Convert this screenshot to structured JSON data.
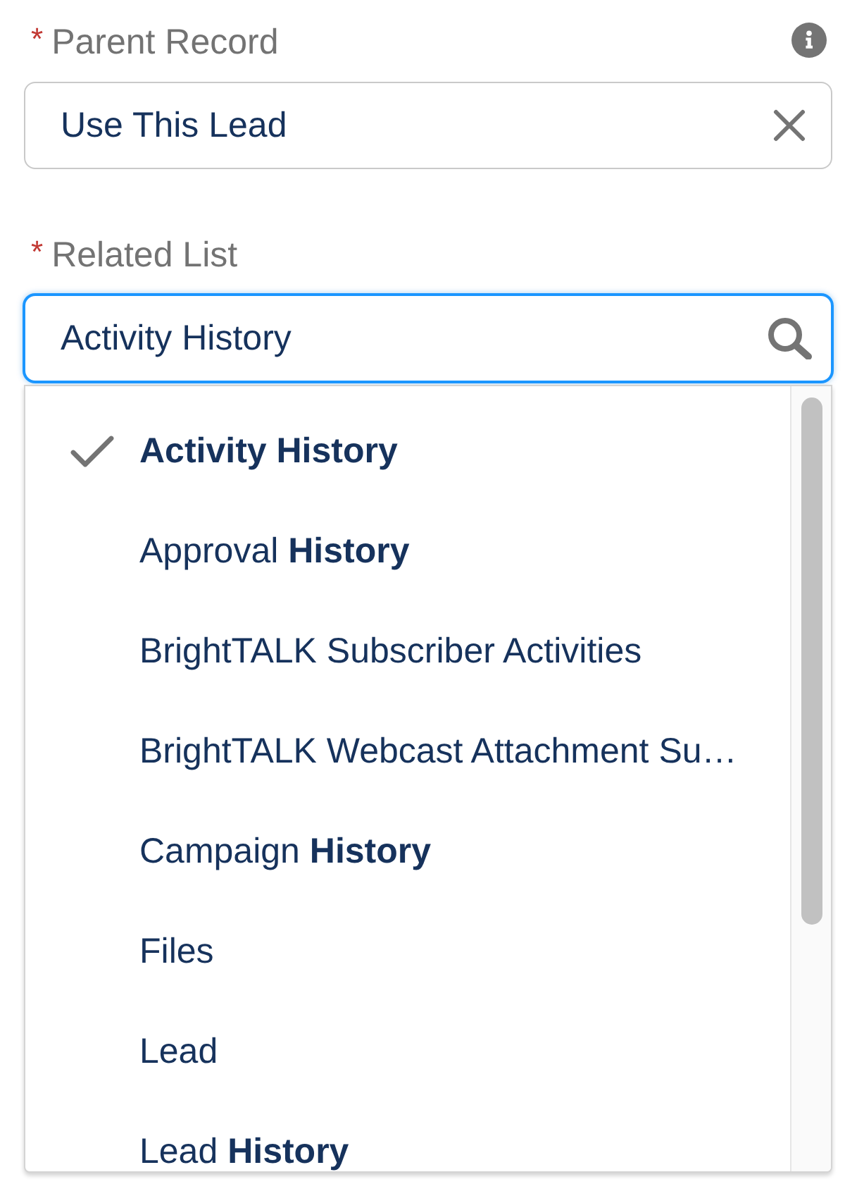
{
  "fields": [
    {
      "kind": "lookup",
      "required_marker": "*",
      "label": "Parent Record",
      "help": true,
      "focused": false,
      "value": "Use This Lead"
    },
    {
      "kind": "search",
      "required_marker": "*",
      "label": "Related List",
      "help": false,
      "focused": true,
      "value": "Activity History",
      "options": [
        {
          "label": "Activity History",
          "selected": true
        },
        {
          "label": "Approval **History**",
          "selected": false
        },
        {
          "label": "BrightTALK Subscriber Activities",
          "selected": false
        },
        {
          "label": "BrightTALK Webcast Attachment Su…",
          "selected": false
        },
        {
          "label": "Campaign **History**",
          "selected": false
        },
        {
          "label": "Files",
          "selected": false
        },
        {
          "label": "Lead",
          "selected": false
        },
        {
          "label": "Lead **History**",
          "selected": false
        }
      ]
    }
  ]
}
